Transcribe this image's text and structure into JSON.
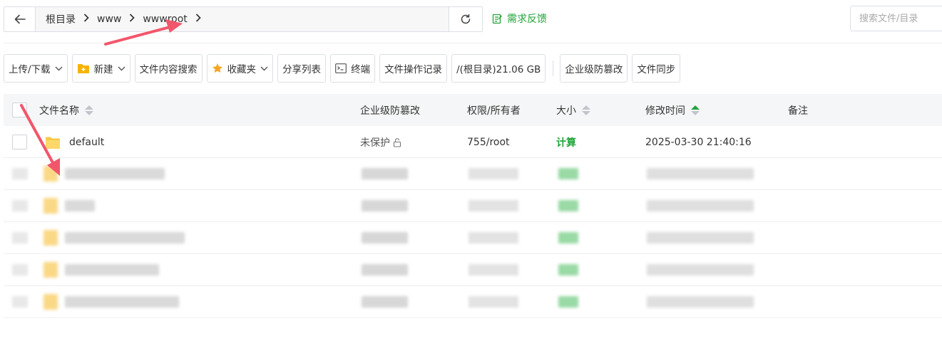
{
  "pathbar": {
    "breadcrumbs": [
      "根目录",
      "www",
      "wwwroot"
    ]
  },
  "feedback": {
    "label": "需求反馈"
  },
  "search": {
    "placeholder": "搜索文件/目录"
  },
  "toolbar": {
    "upload_download": "上传/下载",
    "new": "新建",
    "content_search": "文件内容搜索",
    "favorites": "收藏夹",
    "share_list": "分享列表",
    "terminal": "终端",
    "op_log": "文件操作记录",
    "disk_usage": "/(根目录)21.06 GB",
    "tamper_proof": "企业级防篡改",
    "file_sync": "文件同步"
  },
  "table": {
    "headers": {
      "name": "文件名称",
      "tamper": "企业级防篡改",
      "perm": "权限/所有者",
      "size": "大小",
      "mtime": "修改时间",
      "note": "备注"
    },
    "rows": [
      {
        "name": "default",
        "tamper": "未保护",
        "perm": "755/root",
        "size": "计算",
        "mtime": "2025-03-30 21:40:16",
        "note": ""
      }
    ]
  },
  "colors": {
    "accent": "#20a53a",
    "folder": "#f7c948",
    "arrow": "#f2566b"
  }
}
